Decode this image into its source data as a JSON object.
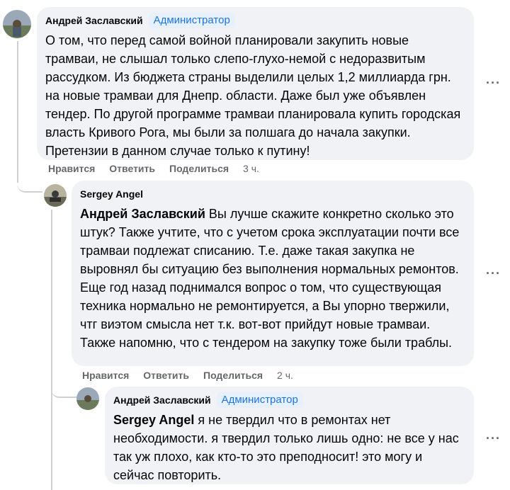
{
  "comments": [
    {
      "author": "Андрей Заславский",
      "badge": "Администратор",
      "text": "О том, что перед самой войной планировали закупить новые трамваи, не слышал только слепо-глухо-немой с недоразвитым рассудком. Из бюджета страны выделили целых 1,2 миллиарда грн. на новые трамваи для Днепр. области. Даже был уже объявлен тендер. По другой программе трамваи планировала купить городская власть Кривого Рога, мы были за полшага до начала закупки. Претензии в данном случае только к путину!",
      "like": "Нравится",
      "reply": "Ответить",
      "share": "Поделиться",
      "time": "3 ч."
    },
    {
      "author": "Sergey Angel",
      "mention": "Андрей Заславский",
      "text": " Вы лучше скажите конкретно сколько это штук? Также учтите, что с учетом срока эксплуатации почти все трамваи подлежат списанию. Т.е. даже такая закупка не выровнял бы ситуацию без выполнения нормальных ремонтов. Еще год назад поднимался вопрос о том, что существующая техника нормально не ремонтируется, а Вы упорно твержили, чтг виэтом смысла нет т.к. вот-вот прийдут новые трамваи. Также напомню, что с тендером на закупку тоже были траблы.",
      "like": "Нравится",
      "reply": "Ответить",
      "share": "Поделиться",
      "time": "2 ч."
    },
    {
      "author": "Андрей Заславский",
      "badge": "Администратор",
      "mention": "Sergey Angel",
      "text": " я не твердил что в ремонтах нет необходимости. я твердил только лишь одно: не все у нас так уж плохо, как кто-то это преподносит! это могу и сейчас повторить."
    }
  ],
  "icons": {
    "more": "more-options-icon"
  }
}
